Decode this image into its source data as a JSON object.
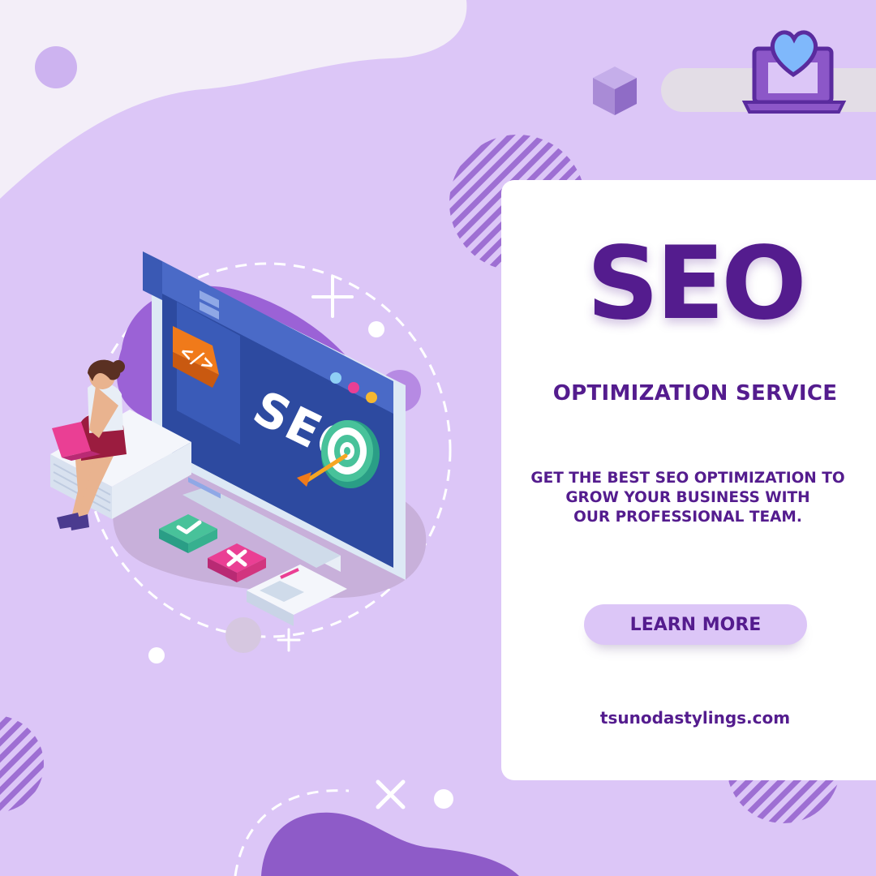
{
  "headline": "SEO",
  "subheadline": "OPTIMIZATION SERVICE",
  "description": [
    "GET THE BEST SEO OPTIMIZATION TO",
    "GROW YOUR BUSINESS WITH",
    "OUR PROFESSIONAL TEAM."
  ],
  "cta_label": "LEARN MORE",
  "website": "tsunodastylings.com",
  "illustration": {
    "screen_text": "SEO",
    "code_badge": "</>",
    "icons": [
      "laptop-heart-icon",
      "cube-icon",
      "target-icon",
      "arrow-icon",
      "check-icon",
      "close-icon",
      "sparkle-icon"
    ]
  },
  "colors": {
    "background": "#dcc6f7",
    "brand": "#541c8e",
    "card": "#ffffff",
    "accent_orange": "#f07a1a",
    "accent_green": "#48c29a",
    "accent_pink": "#ea3f94",
    "monitor_blue": "#2d4aa0"
  }
}
